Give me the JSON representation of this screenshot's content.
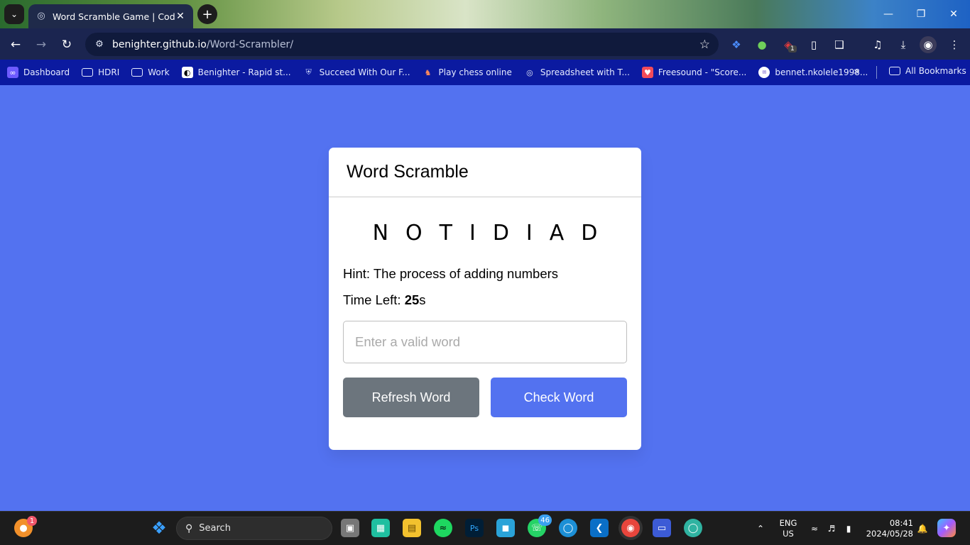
{
  "browser": {
    "tab_title": "Word Scramble Game | CodingNepal",
    "url_host": "benighter.github.io",
    "url_path": "/Word-Scrambler/",
    "new_tab_symbol": "+",
    "extension_badge": "1",
    "bookmarks": [
      {
        "label": "Dashboard",
        "icon": "dashboard-icon",
        "color": "#6e5bff"
      },
      {
        "label": "HDRI",
        "icon": "folder-icon",
        "color": ""
      },
      {
        "label": "Work",
        "icon": "folder-icon",
        "color": ""
      },
      {
        "label": "Benighter - Rapid st...",
        "icon": "site-icon",
        "color": "#ffffff"
      },
      {
        "label": "Succeed With Our F...",
        "icon": "shield-icon",
        "color": ""
      },
      {
        "label": "Play chess online",
        "icon": "chess-icon",
        "color": ""
      },
      {
        "label": "Spreadsheet with T...",
        "icon": "globe-icon",
        "color": ""
      },
      {
        "label": "Freesound - \"Score...",
        "icon": "freesound-icon",
        "color": "#f24b5a"
      },
      {
        "label": "bennet.nkolele1998...",
        "icon": "mail-icon",
        "color": "#ffffff"
      }
    ],
    "all_bookmarks": "All Bookmarks"
  },
  "game": {
    "title": "Word Scramble",
    "scrambled_word": "NOTIDIAD",
    "hint_label": "Hint:",
    "hint_text": "The process of adding numbers",
    "time_label": "Time Left:",
    "time_value": "25",
    "time_unit": "s",
    "input_placeholder": "Enter a valid word",
    "input_value": "",
    "refresh_label": "Refresh Word",
    "check_label": "Check Word"
  },
  "taskbar": {
    "search_label": "Search",
    "whatsapp_badge": "46",
    "notification_badge": "1",
    "lang_top": "ENG",
    "lang_bottom": "US",
    "time": "08:41",
    "date": "2024/05/28"
  },
  "colors": {
    "page_background": "#5372f0",
    "refresh_button": "#6c757d",
    "check_button": "#5372f0",
    "bookmark_bar": "#0b1aa0"
  }
}
